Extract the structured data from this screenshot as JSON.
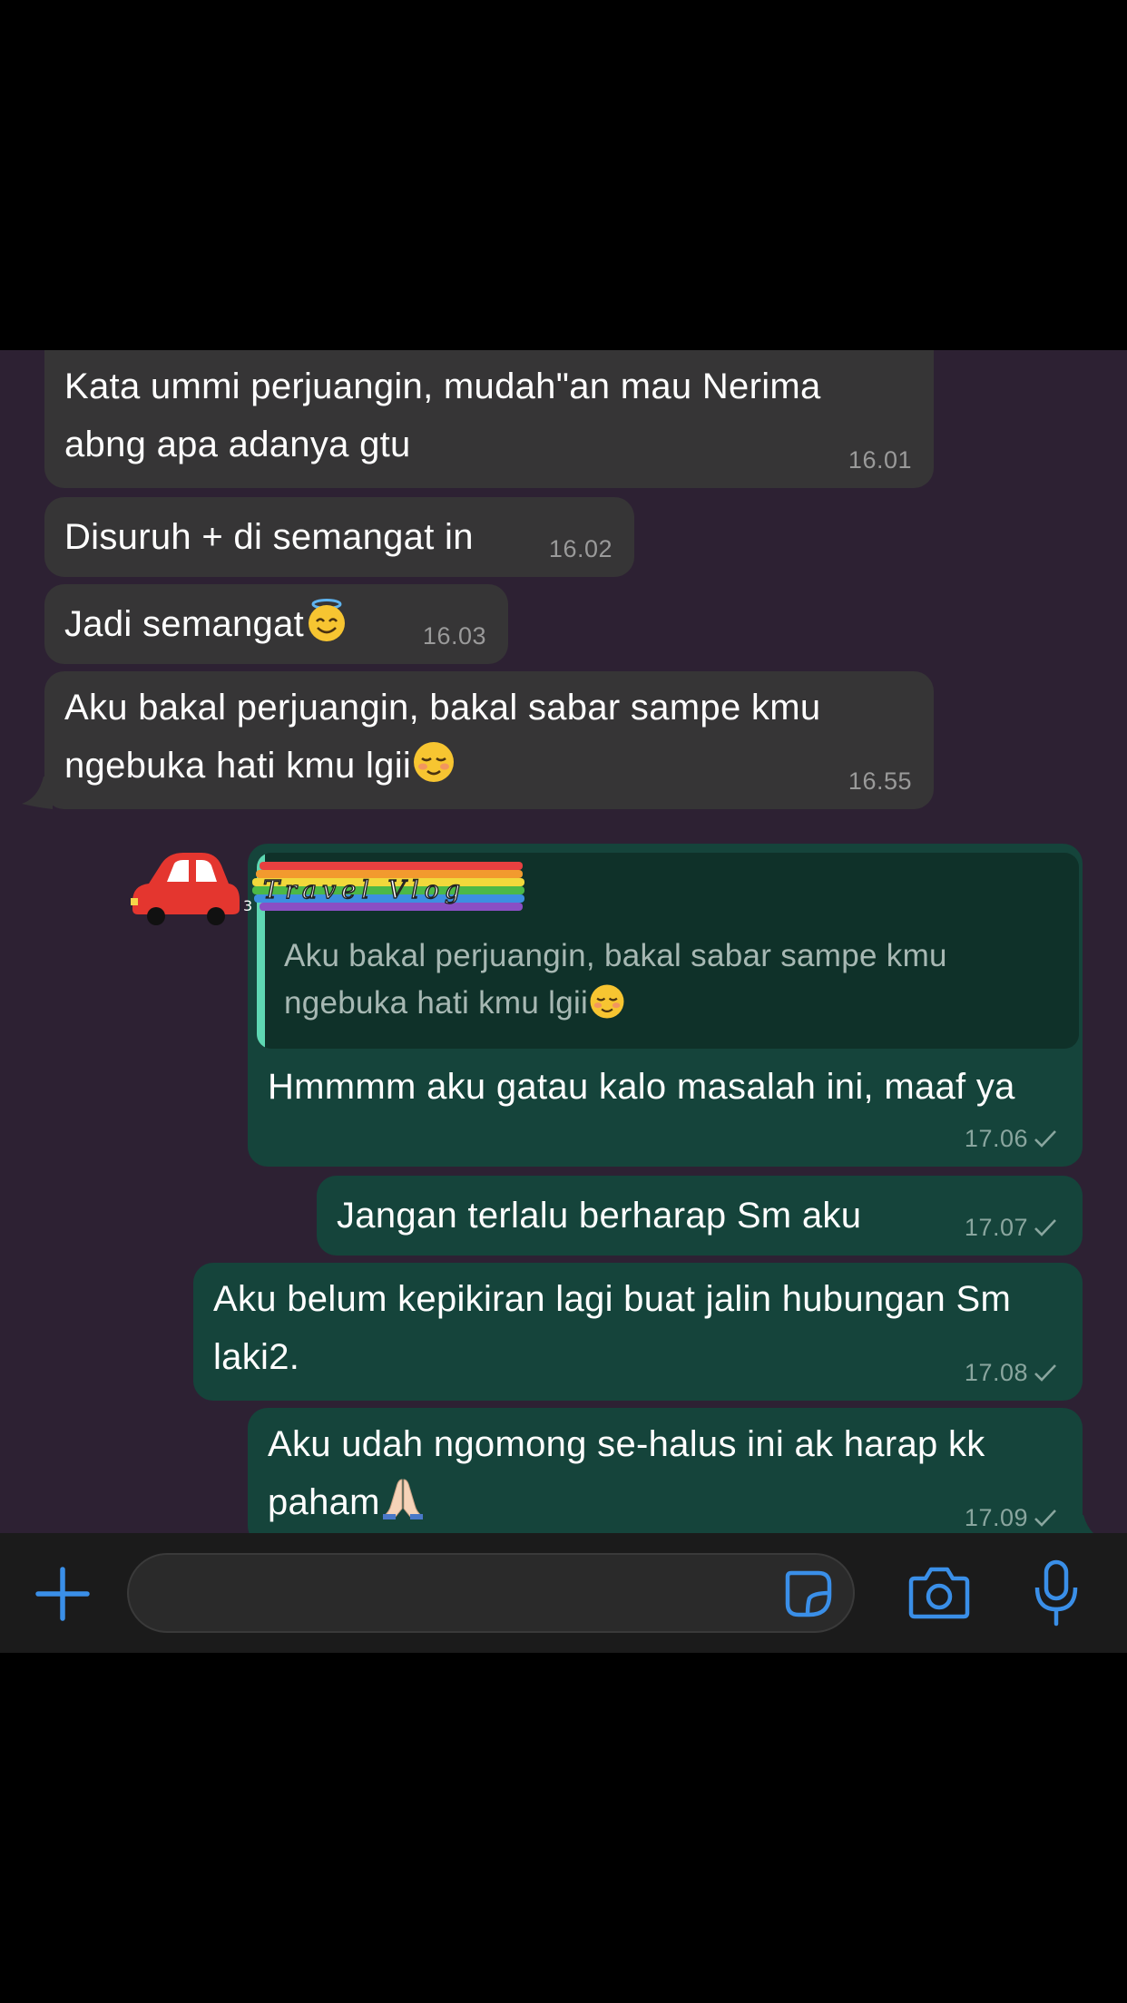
{
  "messages": [
    {
      "id": "m1",
      "direction": "incoming",
      "lines": [
        "Kata ummi perjuangin, mudah\"an mau Nerima",
        "abng apa adanya gtu"
      ],
      "time": "16.01"
    },
    {
      "id": "m2",
      "direction": "incoming",
      "lines": [
        "Disuruh + di semangat in"
      ],
      "time": "16.02"
    },
    {
      "id": "m3",
      "direction": "incoming",
      "lines": [
        "Jadi semangat"
      ],
      "emoji": "smiling-halo-emoji",
      "time": "16.03"
    },
    {
      "id": "m4",
      "direction": "incoming",
      "lines": [
        "Aku bakal perjuangin, bakal sabar sampe kmu",
        "ngebuka hati kmu lgii"
      ],
      "emoji": "relieved-blush-emoji",
      "time": "16.55"
    },
    {
      "id": "m5",
      "direction": "outgoing",
      "quote": {
        "lines": [
          "Aku bakal perjuangin, bakal sabar sampe kmu",
          "ngebuka hati kmu lgii"
        ],
        "emoji": "relieved-blush-emoji"
      },
      "lines": [
        "Hmmmm aku gatau kalo masalah ini, maaf ya"
      ],
      "time": "17.06"
    },
    {
      "id": "m6",
      "direction": "outgoing",
      "lines": [
        "Jangan terlalu berharap Sm aku"
      ],
      "time": "17.07"
    },
    {
      "id": "m7",
      "direction": "outgoing",
      "lines": [
        "Aku belum kepikiran lagi buat jalin hubungan Sm",
        "laki2."
      ],
      "time": "17.08"
    },
    {
      "id": "m8",
      "direction": "outgoing",
      "lines": [
        "Aku udah ngomong se-halus ini ak harap kk",
        "paham"
      ],
      "emoji": "folded-hands-emoji",
      "time": "17.09"
    }
  ],
  "sticker": {
    "text": "Travel Vlog",
    "icon": "red-car-icon"
  },
  "composer": {
    "attach_icon": "plus-icon",
    "sticker_icon": "sticker-icon",
    "camera_icon": "camera-icon",
    "mic_icon": "microphone-icon",
    "input_value": ""
  },
  "colors": {
    "chat_background": "#2d2133",
    "incoming_bubble": "#363536",
    "outgoing_bubble": "#15443b",
    "quote_bar": "#5ed8b3",
    "accent_blue": "#3a8fe8"
  }
}
